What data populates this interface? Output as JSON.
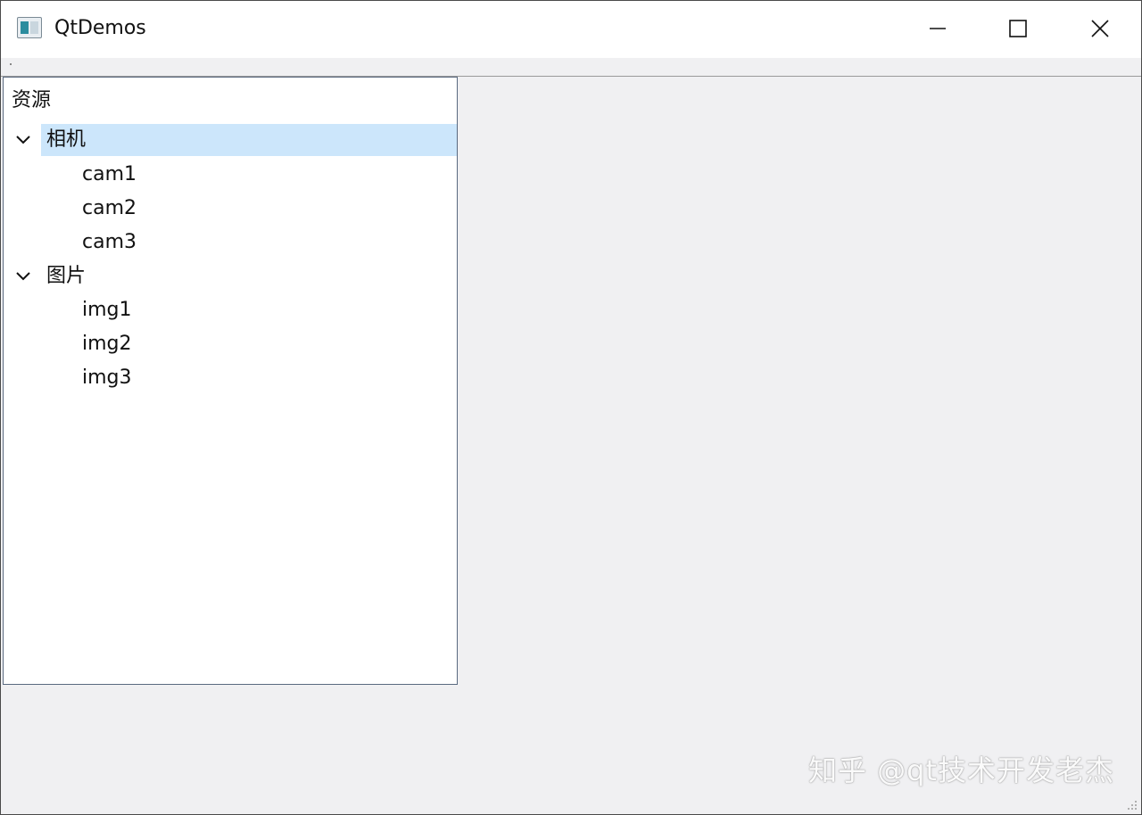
{
  "window": {
    "title": "QtDemos",
    "icon": "app-window-icon"
  },
  "controls": {
    "minimize_icon": "minimize-icon",
    "maximize_icon": "maximize-icon",
    "close_icon": "close-icon"
  },
  "tree": {
    "header": "资源",
    "groups": [
      {
        "label": "相机",
        "expanded": true,
        "selected": true,
        "children": [
          "cam1",
          "cam2",
          "cam3"
        ]
      },
      {
        "label": "图片",
        "expanded": true,
        "selected": false,
        "children": [
          "img1",
          "img2",
          "img3"
        ]
      }
    ]
  },
  "watermark": "知乎 @qt技术开发老杰",
  "colors": {
    "selection": "#cce6fb",
    "content_bg": "#f0f0f2",
    "tree_border": "#5a6a80"
  }
}
